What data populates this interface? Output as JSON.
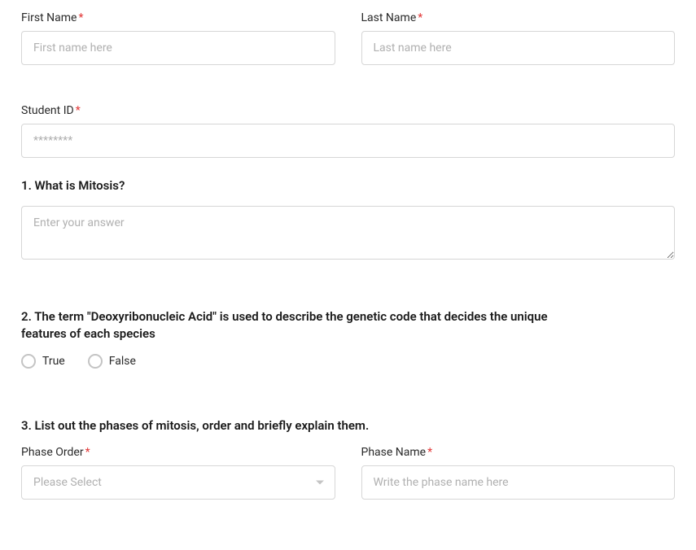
{
  "personal": {
    "firstName": {
      "label": "First Name",
      "required": "*",
      "placeholder": "First name here"
    },
    "lastName": {
      "label": "Last Name",
      "required": "*",
      "placeholder": "Last name here"
    },
    "studentId": {
      "label": "Student ID",
      "required": "*",
      "placeholder": "********"
    }
  },
  "q1": {
    "prompt": "1. What is Mitosis?",
    "placeholder": "Enter your answer"
  },
  "q2": {
    "prompt": "2. The term \"Deoxyribonucleic Acid\" is used to describe the genetic code that decides the unique features of each species",
    "options": {
      "true": "True",
      "false": "False"
    }
  },
  "q3": {
    "prompt": "3. List out the phases of mitosis, order and briefly explain them.",
    "phaseOrder": {
      "label": "Phase Order",
      "required": "*",
      "placeholder": "Please Select"
    },
    "phaseName": {
      "label": "Phase Name",
      "required": "*",
      "placeholder": "Write the phase name here"
    }
  }
}
